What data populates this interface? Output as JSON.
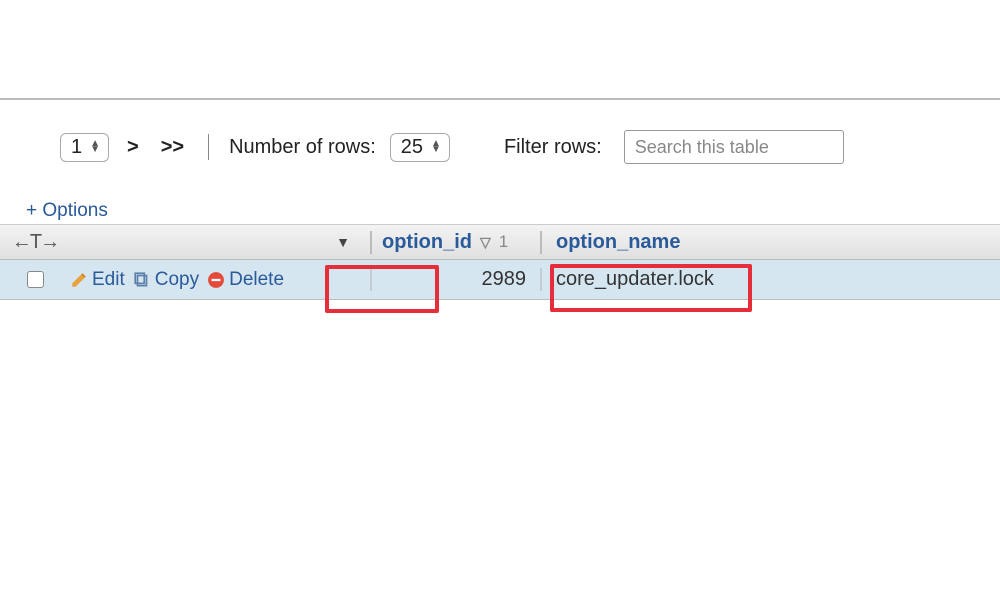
{
  "toolbar": {
    "page_select": "1",
    "next_btn": ">",
    "last_btn": ">>",
    "rows_label": "Number of rows:",
    "rows_value": "25",
    "filter_label": "Filter rows:",
    "filter_placeholder": "Search this table"
  },
  "options_link": "+ Options",
  "header": {
    "col_tools_glyph": "←T→",
    "col_id": "option_id",
    "sort_index": "1",
    "col_name": "option_name"
  },
  "row": {
    "edit": "Edit",
    "copy": "Copy",
    "delete": "Delete",
    "option_id": "2989",
    "option_name": "core_updater.lock"
  }
}
